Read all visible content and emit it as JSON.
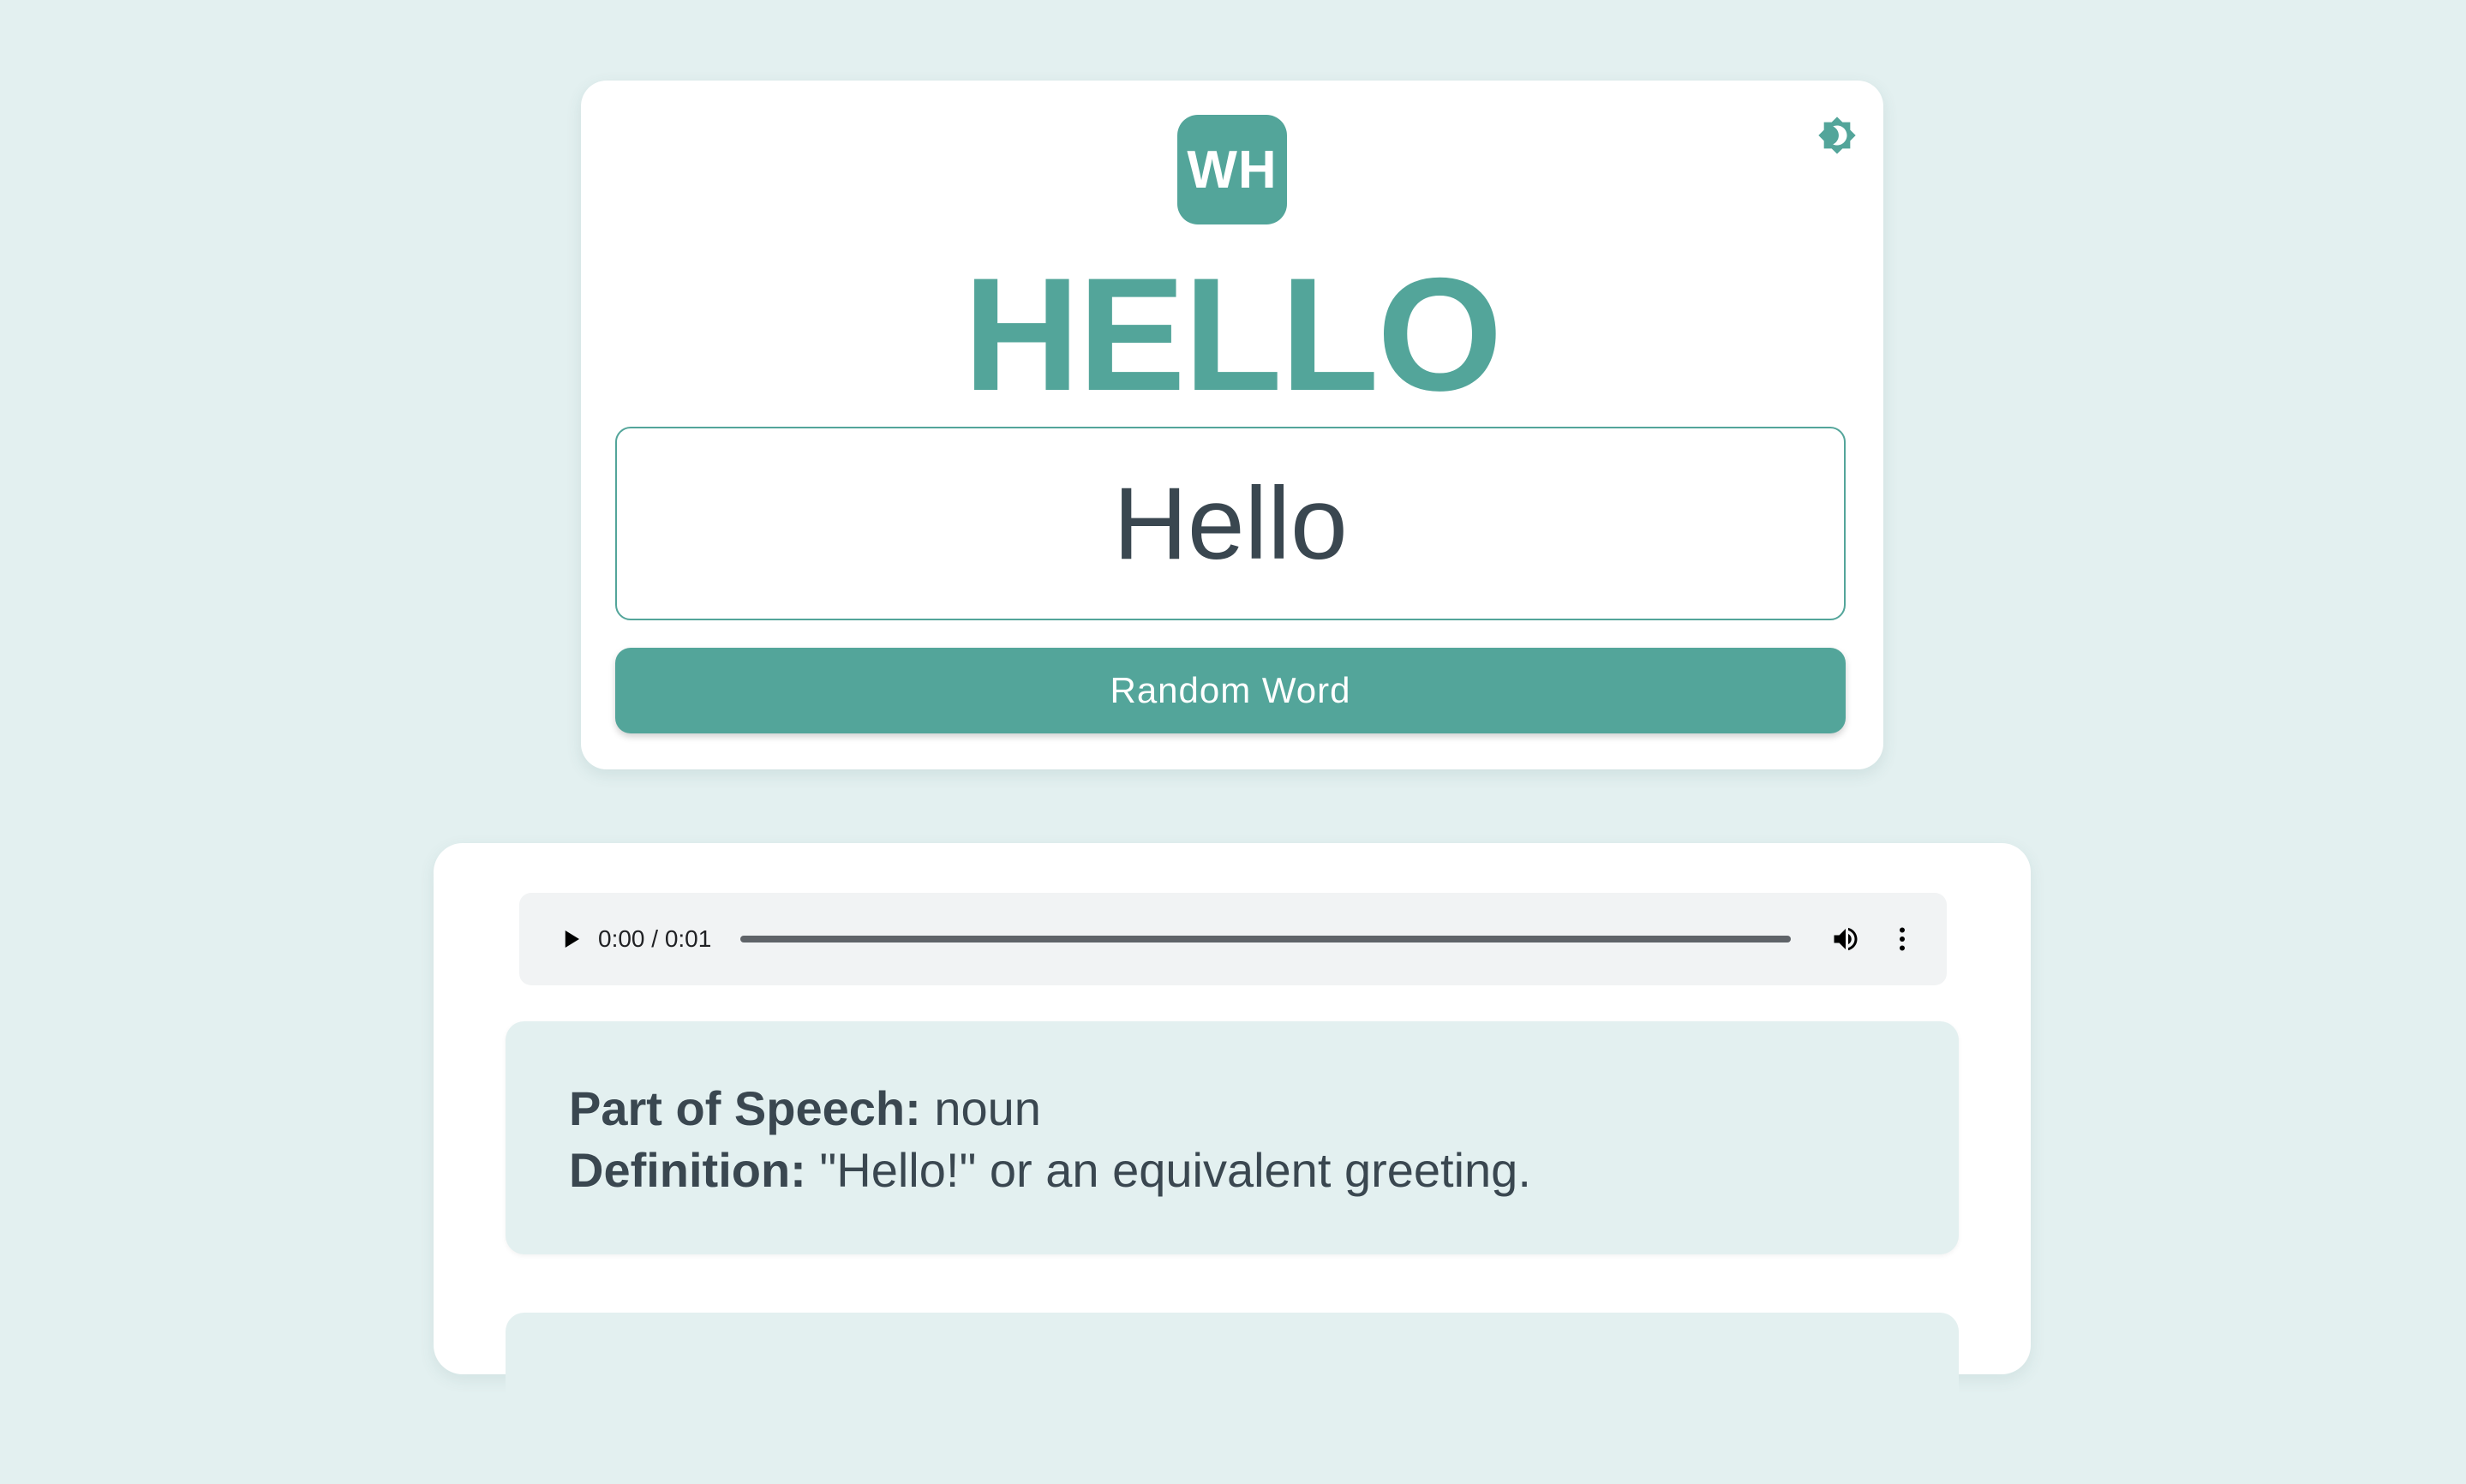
{
  "app": {
    "logo_text": "WH",
    "theme_toggle_icon": "brightness-icon"
  },
  "word": {
    "display": "HELLO",
    "input_value": "Hello"
  },
  "actions": {
    "random_label": "Random Word"
  },
  "audio": {
    "time": "0:00 / 0:01",
    "progress": 0
  },
  "definition": {
    "pos_label": "Part of Speech:",
    "pos_value": " noun",
    "def_label": "Definition:",
    "def_value": " \"Hello!\" or an equivalent greeting."
  },
  "colors": {
    "accent": "#53a59a",
    "background": "#e3f0f0",
    "text": "#3a4750"
  }
}
